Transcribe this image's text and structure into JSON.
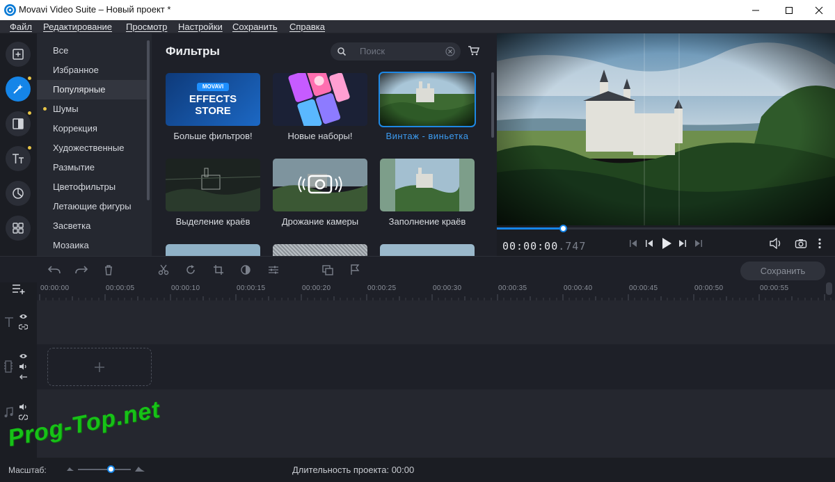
{
  "window": {
    "title": "Movavi Video Suite – Новый проект *"
  },
  "menu": [
    "Файл",
    "Редактирование",
    "Просмотр",
    "Настройки",
    "Сохранить",
    "Справка"
  ],
  "sidebar_tools": [
    {
      "icon": "import-icon",
      "active": false,
      "badge": false
    },
    {
      "icon": "magic-wand-icon",
      "active": true,
      "badge": true
    },
    {
      "icon": "transitions-icon",
      "active": false,
      "badge": true
    },
    {
      "icon": "text-titles-icon",
      "active": false,
      "badge": true
    },
    {
      "icon": "stickers-icon",
      "active": false,
      "badge": false
    },
    {
      "icon": "more-tools-icon",
      "active": false,
      "badge": false
    }
  ],
  "categories": {
    "items": [
      "Все",
      "Избранное",
      "Популярные",
      "Шумы",
      "Коррекция",
      "Художественные",
      "Размытие",
      "Цветофильтры",
      "Летающие фигуры",
      "Засветка",
      "Мозаика"
    ],
    "selected": "Популярные",
    "new_marker": "Шумы"
  },
  "filters": {
    "title": "Фильтры",
    "search_placeholder": "Поиск",
    "store_tile": {
      "badge": "MOVAVI",
      "line1": "EFFECTS",
      "line2": "STORE"
    },
    "tiles": [
      {
        "label": "Больше фильтров!",
        "selected": false
      },
      {
        "label": "Новые наборы!",
        "selected": false
      },
      {
        "label": "Винтаж - виньетка",
        "selected": true
      },
      {
        "label": "Выделение краёв",
        "selected": false
      },
      {
        "label": "Дрожание камеры",
        "selected": false
      },
      {
        "label": "Заполнение краёв",
        "selected": false
      }
    ]
  },
  "player": {
    "timecode_main": "00:00:00",
    "timecode_ms": ".747",
    "progress": 0.195
  },
  "toolbar": {
    "save_label": "Сохранить"
  },
  "timeline": {
    "ruler": [
      "00:00:00",
      "00:00:05",
      "00:00:10",
      "00:00:15",
      "00:00:20",
      "00:00:25",
      "00:00:30",
      "00:00:35",
      "00:00:40",
      "00:00:45",
      "00:00:50",
      "00:00:55"
    ]
  },
  "status": {
    "scale_label": "Масштаб:",
    "zoom_level": 0.62,
    "duration_label": "Длительность проекта:",
    "duration_value": "00:00"
  },
  "watermark": "Prog-Top.net",
  "colors": {
    "accent": "#1585e8",
    "badge_dot": "#e8c547",
    "watermark": "#17c117"
  }
}
